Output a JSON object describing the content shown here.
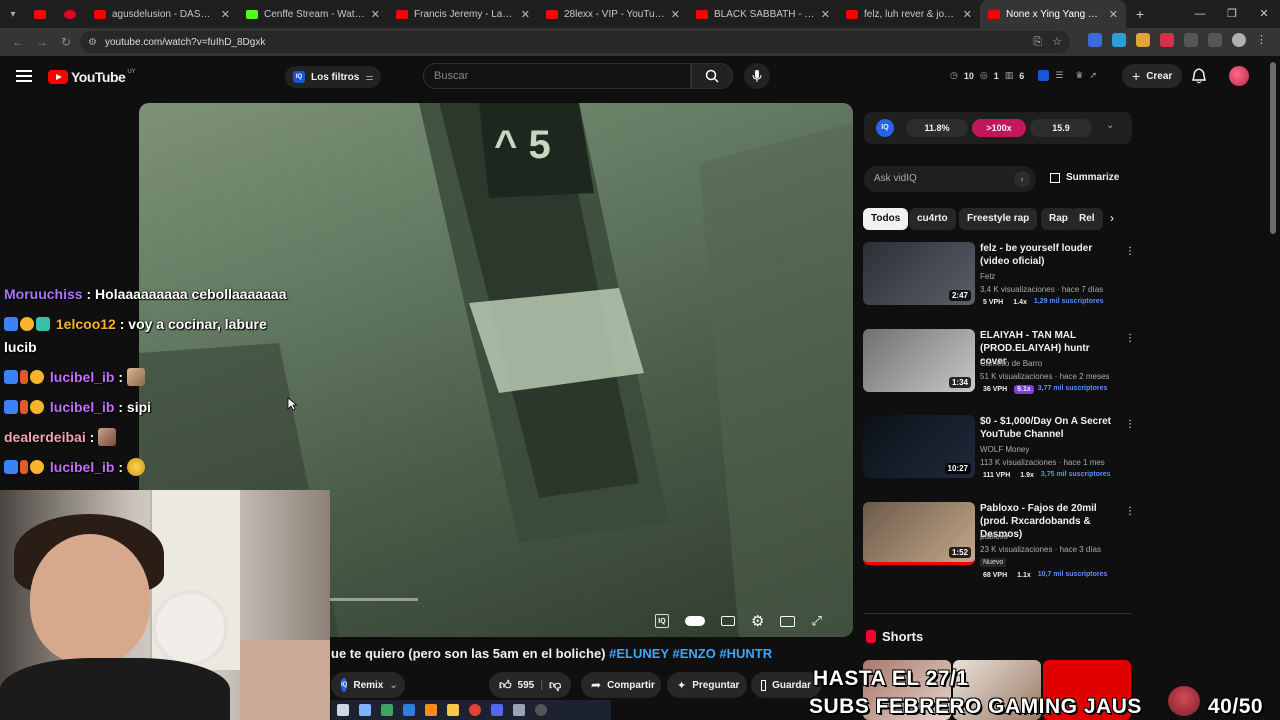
{
  "browser": {
    "tabs": [
      {
        "title": "agusdelusion - DASH - YouTube",
        "favicon": "#ff0000"
      },
      {
        "title": "Cenffe Stream - Watch Live on...",
        "favicon": "#53fc18"
      },
      {
        "title": "Francis Jeremy - Lazerdim (Pe...",
        "favicon": "#ff0000"
      },
      {
        "title": "28lexx - VIP - YouTube",
        "favicon": "#ff0000"
      },
      {
        "title": "BLACK SABBATH - \"Paranoid\"...",
        "favicon": "#ff0000"
      },
      {
        "title": "felz, luh rever & josuforreal...",
        "favicon": "#ff0000"
      },
      {
        "title": "None x Ying Yang x Esta...",
        "favicon": "#ff0000",
        "active": true
      }
    ],
    "url": "youtube.com/watch?v=fuIhD_8Dgxk"
  },
  "masthead": {
    "logo_text": "YouTube",
    "country": "UY",
    "filters_label": "Los filtros",
    "search_placeholder": "Buscar",
    "stats": [
      "10",
      "1",
      "6"
    ],
    "create_label": "Crear"
  },
  "chat": [
    {
      "user": "Moruuchiss",
      "message": "Holaaaaaaaaa cebollaaaaaaa",
      "color": "#a873ff"
    },
    {
      "user": "1elcoo12",
      "message": "voy a cocinar, labure lucib",
      "color": "#f7b32b"
    },
    {
      "user": "lucibel_ib",
      "message": "",
      "emote": true,
      "color": "#c46dff"
    },
    {
      "user": "lucibel_ib",
      "message": "sipi",
      "color": "#c46dff"
    },
    {
      "user": "dealerdeibai",
      "message": "",
      "emote": true,
      "color": "#f0a6b0"
    },
    {
      "user": "lucibel_ib",
      "message": "",
      "emote": true,
      "color": "#c46dff"
    }
  ],
  "video": {
    "title_text": "ue te quiero (pero son las 5am en el boliche) ",
    "title_tags": "#ELUNEY #ENZO #HUNTR"
  },
  "actions": {
    "remix": "Remix",
    "likes": "595",
    "share": "Compartir",
    "ask": "Preguntar",
    "save": "Guardar"
  },
  "vidiq": {
    "metric1": "11.8%",
    "metric2": ">100x",
    "metric3": "15.9",
    "ask_placeholder": "Ask vidIQ",
    "summarize": "Summarize"
  },
  "chips": [
    "Todos",
    "cu4rto",
    "Freestyle rap",
    "Rap",
    "Rel"
  ],
  "recommendations": [
    {
      "title": "felz - be yourself louder (video oficial)",
      "channel": "Felz",
      "meta": "3,4 K visualizaciones · hace 7 días",
      "duration": "2:47",
      "vph": "5 VPH",
      "mult": "1.4x",
      "subs": "1,29 mil suscriptores",
      "thumb": [
        "#2b2f36",
        "#5a5f68"
      ]
    },
    {
      "title": "ELAIYAH - TAN MAL (PROD.ELAIYAH) huntr cover",
      "channel": "Camello de Barro",
      "meta": "51 K visualizaciones · hace 2 meses",
      "duration": "1:34",
      "vph": "36 VPH",
      "mult": "9.1x",
      "subs": "3,77 mil suscriptores",
      "thumb": [
        "#707070",
        "#c8c8c8"
      ]
    },
    {
      "title": "$0 - $1,000/Day On A Secret YouTube Channel",
      "channel": "WOLF Money",
      "meta": "113 K visualizaciones · hace 1 mes",
      "duration": "10:27",
      "vph": "111 VPH",
      "mult": "1.9x",
      "subs": "3,75 mil suscriptores",
      "thumb": [
        "#0c1118",
        "#1e2a3a"
      ]
    },
    {
      "title": "Pabloxo - Fajos de 20mil (prod. Rxcardobands & Desmos)",
      "channel": "pabloxo",
      "meta": "23 K visualizaciones · hace 3 días",
      "duration": "1:52",
      "badge": "Nuevo",
      "vph": "68 VPH",
      "mult": "1.1x",
      "subs": "10,7 mil suscriptores",
      "thumb": [
        "#6b5a4a",
        "#c4a889"
      ]
    }
  ],
  "shorts_label": "Shorts",
  "overlay": {
    "line1": "HASTA EL 27/1",
    "line2": "SUBS FEBRERO GAMING JAUS",
    "counter": "40/50"
  }
}
